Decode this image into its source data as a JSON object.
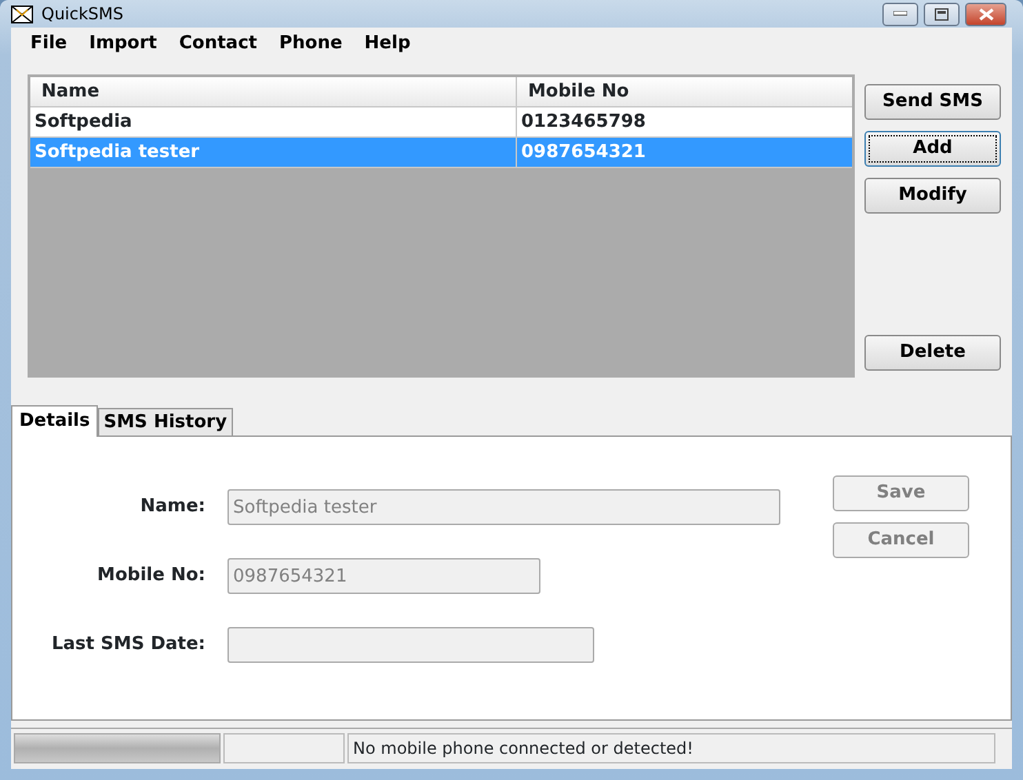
{
  "window": {
    "title": "QuickSMS"
  },
  "menu": [
    "File",
    "Import",
    "Contact",
    "Phone",
    "Help"
  ],
  "contacts": {
    "columns": [
      "Name",
      "Mobile No"
    ],
    "rows": [
      {
        "cells": [
          "Softpedia",
          "0123465798"
        ],
        "selected": false
      },
      {
        "cells": [
          "Softpedia tester",
          "0987654321"
        ],
        "selected": true
      }
    ]
  },
  "side_buttons": [
    {
      "label": "Send SMS",
      "focused": false
    },
    {
      "label": "Add",
      "focused": true
    },
    {
      "label": "Modify",
      "focused": false
    },
    {
      "label": "Delete",
      "focused": false
    }
  ],
  "tabs": [
    {
      "label": "Details",
      "selected": true
    },
    {
      "label": "SMS History",
      "selected": false
    }
  ],
  "details": {
    "fields": [
      {
        "label": "Name:",
        "value": "Softpedia tester",
        "disabled": true
      },
      {
        "label": "Mobile No:",
        "value": "0987654321",
        "disabled": true
      },
      {
        "label": "Last SMS Date:",
        "disabled": true
      }
    ],
    "buttons": [
      {
        "label": "Save",
        "disabled": true
      },
      {
        "label": "Cancel",
        "disabled": true
      }
    ]
  },
  "status_bar": {
    "progress": {
      "level": 1
    },
    "message": "No mobile phone connected or detected!"
  }
}
